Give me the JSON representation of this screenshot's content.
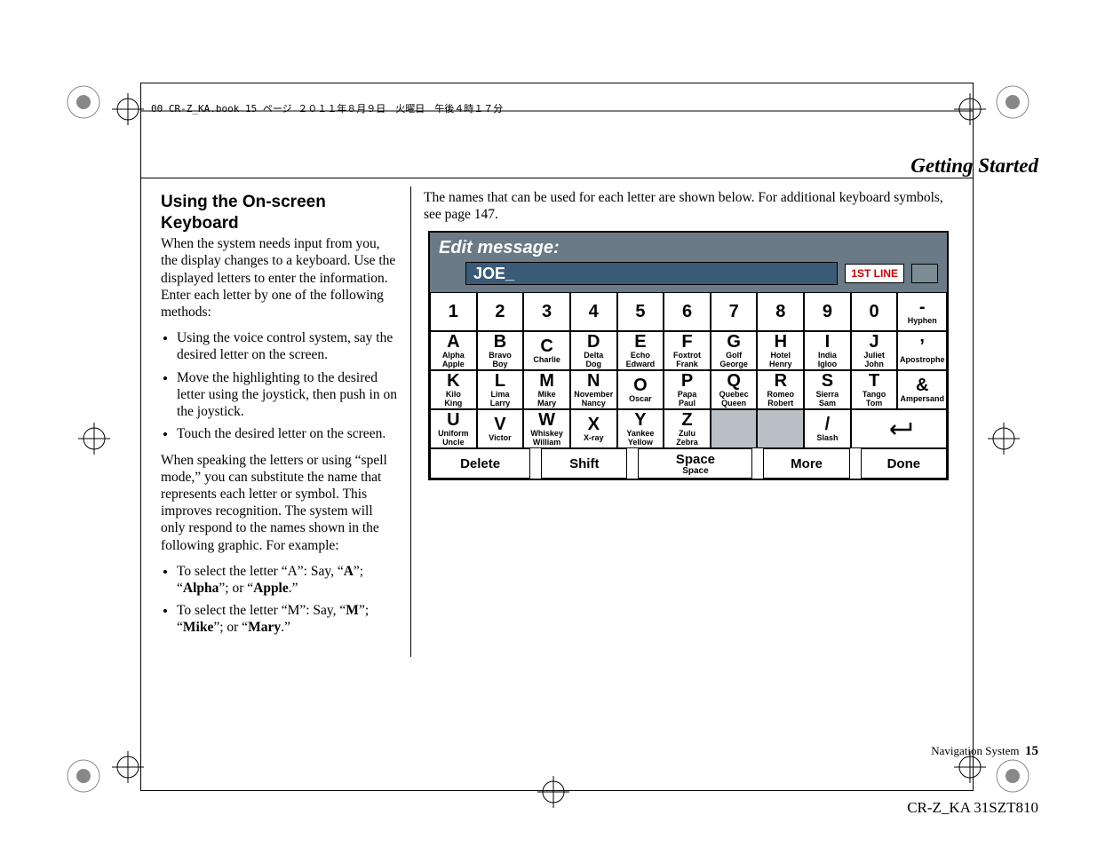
{
  "header_mark": "00 CR-Z_KA.book  15 ページ  ２０１１年８月９日　火曜日　午後４時１７分",
  "chapter_title": "Getting Started",
  "left": {
    "h2": "Using the On-screen Keyboard",
    "p1": "When the system needs input from you, the display changes to a keyboard. Use the displayed letters to enter the information. Enter each letter by one of the following methods:",
    "b1": "Using the voice control system, say the desired letter on the screen.",
    "b2": "Move the highlighting to the desired letter using the joystick, then push in on the joystick.",
    "b3": "Touch the desired letter on the screen.",
    "p2": "When speaking the letters or using “spell mode,” you can substitute the name that represents each letter or symbol. This improves recognition. The system will only respond to the names shown in the following graphic. For example:",
    "ex1_pre": "To select the letter “A”: Say, “",
    "ex1_a": "A",
    "ex1_mid": "”; “",
    "ex1_b": "Alpha",
    "ex1_mid2": "”; or “",
    "ex1_c": "Apple",
    "ex1_end": ".”",
    "ex2_pre": "To select the letter “M”: Say, “",
    "ex2_a": "M",
    "ex2_mid": "”; “",
    "ex2_b": "Mike",
    "ex2_mid2": "”; or “",
    "ex2_c": "Mary",
    "ex2_end": ".”"
  },
  "right_intro": "The names that can be used for each letter are shown below. For additional keyboard symbols, see page 147.",
  "kb": {
    "title": "Edit message:",
    "input": "JOE_",
    "badge": "1ST LINE",
    "row_nums": [
      "1",
      "2",
      "3",
      "4",
      "5",
      "6",
      "7",
      "8",
      "9",
      "0"
    ],
    "sym_top": {
      "big": "-",
      "small": "Hyphen"
    },
    "row_a": [
      {
        "l": "A",
        "s": "Alpha\nApple"
      },
      {
        "l": "B",
        "s": "Bravo\nBoy"
      },
      {
        "l": "C",
        "s": "Charlie"
      },
      {
        "l": "D",
        "s": "Delta\nDog"
      },
      {
        "l": "E",
        "s": "Echo\nEdward"
      },
      {
        "l": "F",
        "s": "Foxtrot\nFrank"
      },
      {
        "l": "G",
        "s": "Golf\nGeorge"
      },
      {
        "l": "H",
        "s": "Hotel\nHenry"
      },
      {
        "l": "I",
        "s": "India\nIgloo"
      },
      {
        "l": "J",
        "s": "Juliet\nJohn"
      }
    ],
    "sym_a": {
      "big": "’",
      "small": "Apostrophe"
    },
    "row_k": [
      {
        "l": "K",
        "s": "Kilo\nKing"
      },
      {
        "l": "L",
        "s": "Lima\nLarry"
      },
      {
        "l": "M",
        "s": "Mike\nMary"
      },
      {
        "l": "N",
        "s": "November\nNancy"
      },
      {
        "l": "O",
        "s": "Oscar"
      },
      {
        "l": "P",
        "s": "Papa\nPaul"
      },
      {
        "l": "Q",
        "s": "Quebec\nQueen"
      },
      {
        "l": "R",
        "s": "Romeo\nRobert"
      },
      {
        "l": "S",
        "s": "Sierra\nSam"
      },
      {
        "l": "T",
        "s": "Tango\nTom"
      }
    ],
    "sym_k": {
      "big": "&",
      "small": "Ampersand"
    },
    "row_u": [
      {
        "l": "U",
        "s": "Uniform\nUncle"
      },
      {
        "l": "V",
        "s": "Victor"
      },
      {
        "l": "W",
        "s": "Whiskey\nWilliam"
      },
      {
        "l": "X",
        "s": "X-ray"
      },
      {
        "l": "Y",
        "s": "Yankee\nYellow"
      },
      {
        "l": "Z",
        "s": "Zulu\nZebra"
      }
    ],
    "slash": {
      "big": "/",
      "small": "Slash"
    },
    "bottom": {
      "delete": "Delete",
      "shift": "Shift",
      "space_big": "Space",
      "space_small": "Space",
      "more": "More",
      "done": "Done"
    }
  },
  "footer_label": "Navigation System",
  "footer_page": "15",
  "footer_code": "CR-Z_KA  31SZT810"
}
